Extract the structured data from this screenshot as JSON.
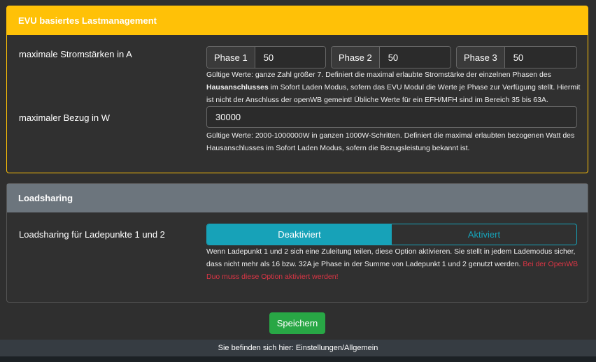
{
  "evu": {
    "title": "EVU basiertes Lastmanagement",
    "current_label": "maximale Stromstärken in A",
    "phases": [
      {
        "label": "Phase 1",
        "value": "50"
      },
      {
        "label": "Phase 2",
        "value": "50"
      },
      {
        "label": "Phase 3",
        "value": "50"
      }
    ],
    "current_help_1": "Gültige Werte: ganze Zahl größer 7. Definiert die maximal erlaubte Stromstärke der einzelnen Phasen des ",
    "current_help_bold": "Hausanschlusses",
    "current_help_2": " im Sofort Laden Modus, sofern das EVU Modul die Werte je Phase zur Verfügung stellt. Hiermit ist nicht der Anschluss der openWB gemeint! Übliche Werte für ein EFH/MFH sind im Bereich 35 bis 63A.",
    "power_label": "maximaler Bezug in W",
    "power_value": "30000",
    "power_help": "Gültige Werte: 2000-1000000W in ganzen 1000W-Schritten. Definiert die maximal erlaubten bezogenen Watt des Hausanschlusses im Sofort Laden Modus, sofern die Bezugsleistung bekannt ist."
  },
  "loadsharing": {
    "title": "Loadsharing",
    "label": "Loadsharing für Ladepunkte 1 und 2",
    "options": [
      "Deaktiviert",
      "Aktiviert"
    ],
    "selected": "Deaktiviert",
    "help": "Wenn Ladepunkt 1 und 2 sich eine Zuleitung teilen, diese Option aktivieren. Sie stellt in jedem Lademodus sicher, dass nicht mehr als 16 bzw. 32A je Phase in der Summe von Ladepunkt 1 und 2 genutzt werden. ",
    "help_warning": "Bei der OpenWB Duo muss diese Option aktiviert werden!"
  },
  "save_label": "Speichern",
  "footer": "Sie befinden sich hier: Einstellungen/Allgemein",
  "colors": {
    "warning": "#ffc107",
    "secondary": "#6c757d",
    "info": "#17a2b8",
    "success": "#28a745",
    "danger": "#dc3545"
  }
}
